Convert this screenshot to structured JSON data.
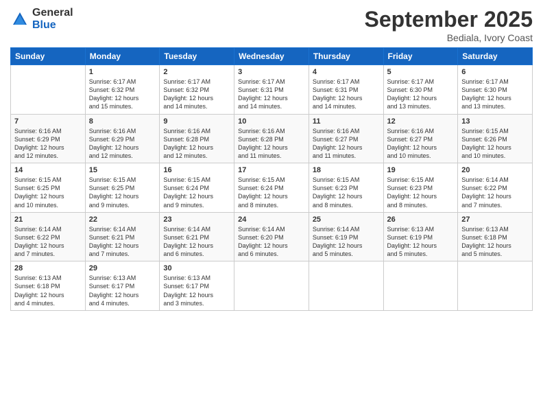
{
  "header": {
    "logo_general": "General",
    "logo_blue": "Blue",
    "month_title": "September 2025",
    "location": "Bediala, Ivory Coast"
  },
  "days_of_week": [
    "Sunday",
    "Monday",
    "Tuesday",
    "Wednesday",
    "Thursday",
    "Friday",
    "Saturday"
  ],
  "weeks": [
    [
      {
        "day": "",
        "info": ""
      },
      {
        "day": "1",
        "info": "Sunrise: 6:17 AM\nSunset: 6:32 PM\nDaylight: 12 hours\nand 15 minutes."
      },
      {
        "day": "2",
        "info": "Sunrise: 6:17 AM\nSunset: 6:32 PM\nDaylight: 12 hours\nand 14 minutes."
      },
      {
        "day": "3",
        "info": "Sunrise: 6:17 AM\nSunset: 6:31 PM\nDaylight: 12 hours\nand 14 minutes."
      },
      {
        "day": "4",
        "info": "Sunrise: 6:17 AM\nSunset: 6:31 PM\nDaylight: 12 hours\nand 14 minutes."
      },
      {
        "day": "5",
        "info": "Sunrise: 6:17 AM\nSunset: 6:30 PM\nDaylight: 12 hours\nand 13 minutes."
      },
      {
        "day": "6",
        "info": "Sunrise: 6:17 AM\nSunset: 6:30 PM\nDaylight: 12 hours\nand 13 minutes."
      }
    ],
    [
      {
        "day": "7",
        "info": "Sunrise: 6:16 AM\nSunset: 6:29 PM\nDaylight: 12 hours\nand 12 minutes."
      },
      {
        "day": "8",
        "info": "Sunrise: 6:16 AM\nSunset: 6:29 PM\nDaylight: 12 hours\nand 12 minutes."
      },
      {
        "day": "9",
        "info": "Sunrise: 6:16 AM\nSunset: 6:28 PM\nDaylight: 12 hours\nand 12 minutes."
      },
      {
        "day": "10",
        "info": "Sunrise: 6:16 AM\nSunset: 6:28 PM\nDaylight: 12 hours\nand 11 minutes."
      },
      {
        "day": "11",
        "info": "Sunrise: 6:16 AM\nSunset: 6:27 PM\nDaylight: 12 hours\nand 11 minutes."
      },
      {
        "day": "12",
        "info": "Sunrise: 6:16 AM\nSunset: 6:27 PM\nDaylight: 12 hours\nand 10 minutes."
      },
      {
        "day": "13",
        "info": "Sunrise: 6:15 AM\nSunset: 6:26 PM\nDaylight: 12 hours\nand 10 minutes."
      }
    ],
    [
      {
        "day": "14",
        "info": "Sunrise: 6:15 AM\nSunset: 6:25 PM\nDaylight: 12 hours\nand 10 minutes."
      },
      {
        "day": "15",
        "info": "Sunrise: 6:15 AM\nSunset: 6:25 PM\nDaylight: 12 hours\nand 9 minutes."
      },
      {
        "day": "16",
        "info": "Sunrise: 6:15 AM\nSunset: 6:24 PM\nDaylight: 12 hours\nand 9 minutes."
      },
      {
        "day": "17",
        "info": "Sunrise: 6:15 AM\nSunset: 6:24 PM\nDaylight: 12 hours\nand 8 minutes."
      },
      {
        "day": "18",
        "info": "Sunrise: 6:15 AM\nSunset: 6:23 PM\nDaylight: 12 hours\nand 8 minutes."
      },
      {
        "day": "19",
        "info": "Sunrise: 6:15 AM\nSunset: 6:23 PM\nDaylight: 12 hours\nand 8 minutes."
      },
      {
        "day": "20",
        "info": "Sunrise: 6:14 AM\nSunset: 6:22 PM\nDaylight: 12 hours\nand 7 minutes."
      }
    ],
    [
      {
        "day": "21",
        "info": "Sunrise: 6:14 AM\nSunset: 6:22 PM\nDaylight: 12 hours\nand 7 minutes."
      },
      {
        "day": "22",
        "info": "Sunrise: 6:14 AM\nSunset: 6:21 PM\nDaylight: 12 hours\nand 7 minutes."
      },
      {
        "day": "23",
        "info": "Sunrise: 6:14 AM\nSunset: 6:21 PM\nDaylight: 12 hours\nand 6 minutes."
      },
      {
        "day": "24",
        "info": "Sunrise: 6:14 AM\nSunset: 6:20 PM\nDaylight: 12 hours\nand 6 minutes."
      },
      {
        "day": "25",
        "info": "Sunrise: 6:14 AM\nSunset: 6:19 PM\nDaylight: 12 hours\nand 5 minutes."
      },
      {
        "day": "26",
        "info": "Sunrise: 6:13 AM\nSunset: 6:19 PM\nDaylight: 12 hours\nand 5 minutes."
      },
      {
        "day": "27",
        "info": "Sunrise: 6:13 AM\nSunset: 6:18 PM\nDaylight: 12 hours\nand 5 minutes."
      }
    ],
    [
      {
        "day": "28",
        "info": "Sunrise: 6:13 AM\nSunset: 6:18 PM\nDaylight: 12 hours\nand 4 minutes."
      },
      {
        "day": "29",
        "info": "Sunrise: 6:13 AM\nSunset: 6:17 PM\nDaylight: 12 hours\nand 4 minutes."
      },
      {
        "day": "30",
        "info": "Sunrise: 6:13 AM\nSunset: 6:17 PM\nDaylight: 12 hours\nand 3 minutes."
      },
      {
        "day": "",
        "info": ""
      },
      {
        "day": "",
        "info": ""
      },
      {
        "day": "",
        "info": ""
      },
      {
        "day": "",
        "info": ""
      }
    ]
  ]
}
